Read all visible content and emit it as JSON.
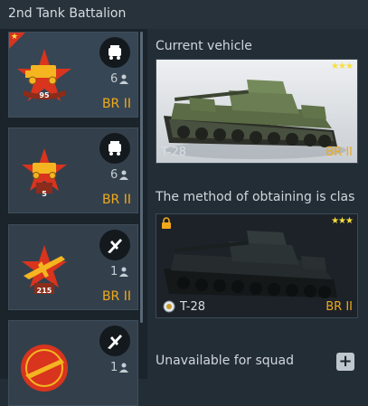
{
  "header": {
    "title": "2nd Tank Battalion"
  },
  "squads": [
    {
      "level": "95",
      "members": "6",
      "br": "BR II",
      "type_icon": "car-icon",
      "selected": true
    },
    {
      "level": "5",
      "members": "6",
      "br": "BR II",
      "type_icon": "car-icon",
      "selected": false
    },
    {
      "level": "215",
      "members": "1",
      "br": "BR II",
      "type_icon": "plane-icon",
      "selected": false
    },
    {
      "level": "",
      "members": "1",
      "br": "",
      "type_icon": "plane-icon",
      "selected": false
    }
  ],
  "current_vehicle": {
    "label": "Current vehicle",
    "name": "T-28",
    "br": "BR II",
    "stars": "★★★"
  },
  "obtaining": {
    "label": "The method of obtaining is clas",
    "name": "T-28",
    "br": "BR II",
    "stars": "★★★"
  },
  "unavailable": {
    "label": "Unavailable for squad",
    "add_label": "+"
  },
  "colors": {
    "accent": "#f0a91c",
    "stars": "#f7df3a",
    "corner": "#d6341f",
    "background": "#232d36"
  }
}
